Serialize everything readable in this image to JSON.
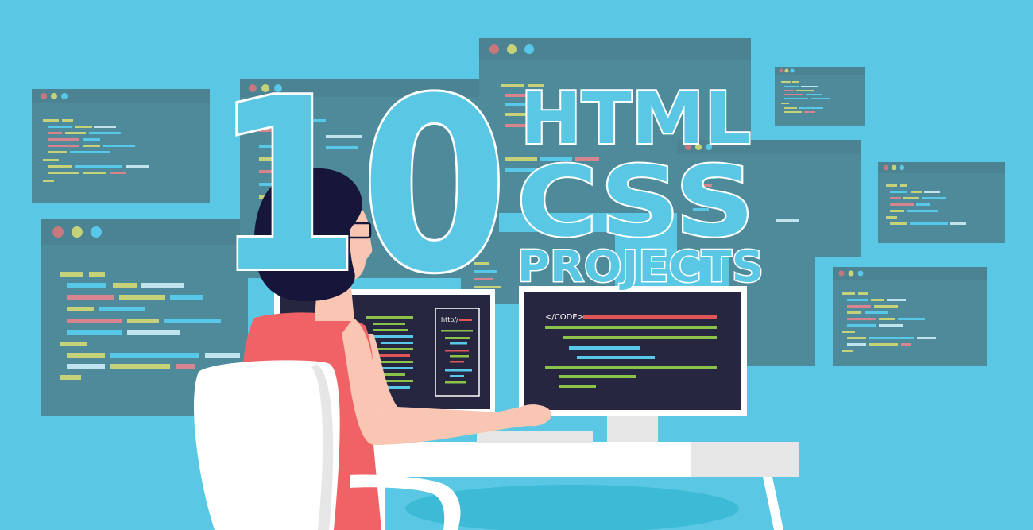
{
  "headline": {
    "number": "10",
    "line1": "HTML",
    "line2": "CSS",
    "line3": "PROJECTS"
  },
  "monitor_left": {
    "url_label": "http//"
  },
  "monitor_right": {
    "code_tag": "</CODE>"
  },
  "palette": {
    "background": "#5ac8e4",
    "window_bg": "#4e8a9a",
    "window_bar": "#4b8393",
    "screen_bg": "#262640",
    "headline_fill": "#5ac8e4",
    "headline_outline": "#ffffff",
    "shirt": "#f06265",
    "hair": "#16163a",
    "skin": "#f8c6b2",
    "desk": "#ffffff",
    "code_green": "#8bc34a",
    "code_blue": "#58c8e8",
    "code_red": "#e05555",
    "code_yellow": "#c6d27a",
    "code_pink": "#d8848f"
  },
  "icons": [
    "traffic-light-dots",
    "woman-illustration",
    "office-chair",
    "desk",
    "monitor"
  ]
}
